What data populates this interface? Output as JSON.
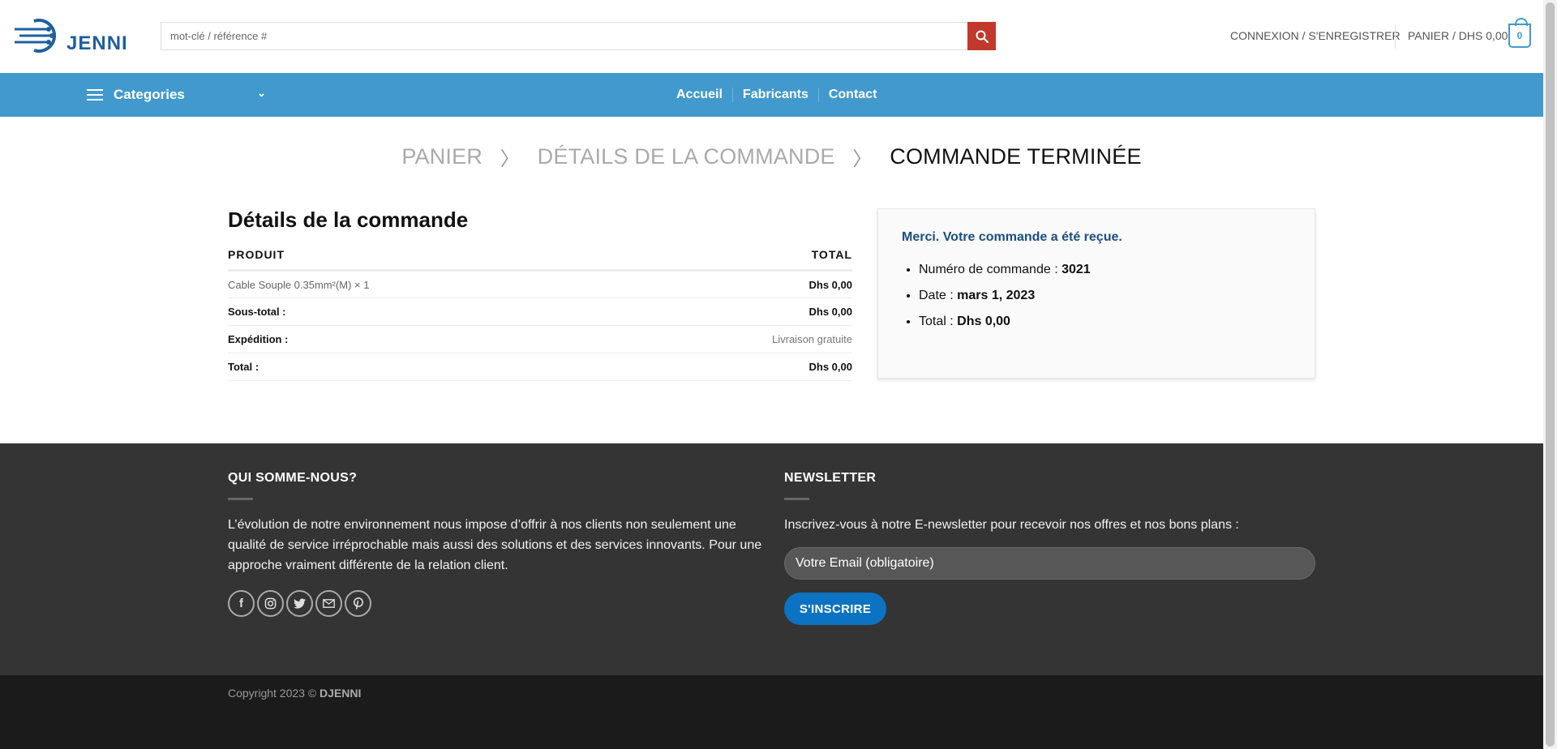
{
  "header": {
    "logo_text": "JENNI",
    "search_placeholder": "mot-clé / référence #",
    "account_link": "CONNEXION / S'ENREGISTRER",
    "cart_link": "PANIER / DHS 0,00",
    "cart_count": "0"
  },
  "nav": {
    "categories_label": "Categories",
    "links": [
      "Accueil",
      "Fabricants",
      "Contact"
    ]
  },
  "steps": {
    "step1": "PANIER",
    "step2": "DÉTAILS DE LA COMMANDE",
    "step3": "COMMANDE TERMINÉE"
  },
  "order": {
    "title": "Détails de la commande",
    "col_product": "PRODUIT",
    "col_total": "TOTAL",
    "product_name": "Cable Souple 0.35mm²(M) × 1",
    "product_total": "Dhs 0,00",
    "subtotal_label": "Sous-total :",
    "subtotal_value": "Dhs 0,00",
    "shipping_label": "Expédition :",
    "shipping_value": "Livraison gratuite",
    "total_label": "Total :",
    "total_value": "Dhs 0,00"
  },
  "thanks": {
    "message": "Merci. Votre commande a été reçue.",
    "order_number_label": "Numéro de commande :",
    "order_number_value": "3021",
    "date_label": "Date :",
    "date_value": "mars 1, 2023",
    "total_label": "Total :",
    "total_value": "Dhs 0,00"
  },
  "footer": {
    "about_title": "QUI SOMME-NOUS?",
    "about_text": "L’évolution de notre environnement nous impose d’offrir à nos clients non seulement une qualité de service irréprochable mais aussi des solutions et des services innovants. Pour une approche vraiment différente de la relation client.",
    "newsletter_title": "NEWSLETTER",
    "newsletter_text": "Inscrivez-vous à notre E-newsletter pour recevoir nos offres et nos bons plans :",
    "email_placeholder": "Votre Email (obligatoire)",
    "subscribe_label": "S'INSCRIRE",
    "copyright_prefix": "Copyright 2023 ©",
    "copyright_brand": "DJENNI"
  },
  "colors": {
    "nav_blue": "#4299cd",
    "search_red": "#c0392b",
    "footer_dark": "#343434",
    "subscribe_blue": "#0b73c1"
  }
}
